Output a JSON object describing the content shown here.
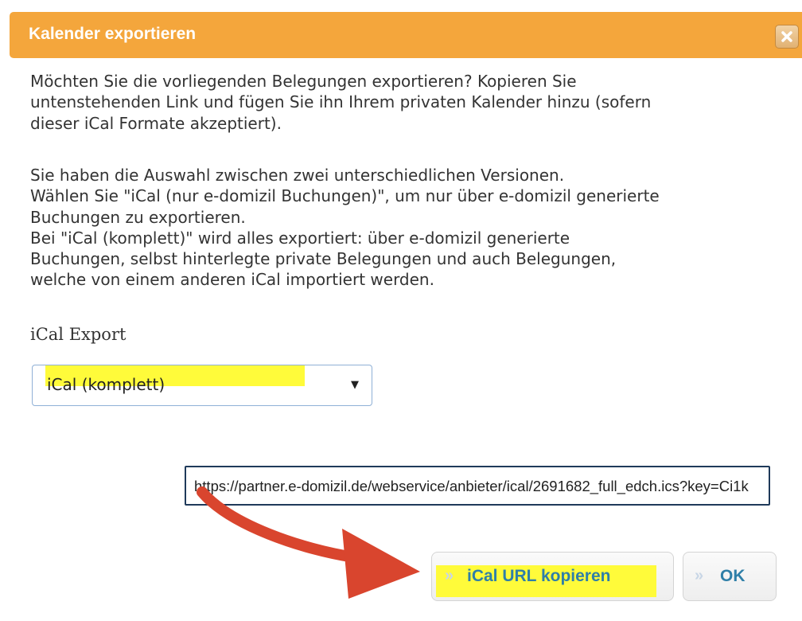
{
  "dialog": {
    "title": "Kalender exportieren",
    "close_icon": "close-icon"
  },
  "intro_lines": [
    "Möchten Sie die vorliegenden Belegungen exportieren? Kopieren Sie",
    "untenstehenden Link und fügen Sie ihn Ihrem privaten Kalender hinzu (sofern",
    "dieser iCal Formate akzeptiert)."
  ],
  "info_lines": [
    "Sie haben die Auswahl zwischen zwei unterschiedlichen Versionen.",
    "Wählen Sie \"iCal (nur e-domizil Buchungen)\", um nur über e-domizil generierte",
    "Buchungen zu exportieren.",
    "Bei \"iCal (komplett)\" wird alles exportiert: über e-domizil generierte",
    "Buchungen, selbst hinterlegte private Belegungen und auch Belegungen,",
    "welche von einem anderen iCal importiert werden."
  ],
  "export": {
    "label": "iCal Export",
    "selected_value": "iCal (komplett)",
    "arrow_glyph": "▼"
  },
  "url_field": {
    "value": "https://partner.e-domizil.de/webservice/anbieter/ical/2691682_full_edch.ics?key=Ci1k"
  },
  "buttons": {
    "copy_label": "iCal URL kopieren",
    "ok_label": "OK",
    "chevrons": "»"
  },
  "colors": {
    "title_bar": "#f4a63c",
    "highlight": "#fffb3a",
    "button_text": "#2f7fa8",
    "arrow": "#d9452e"
  }
}
